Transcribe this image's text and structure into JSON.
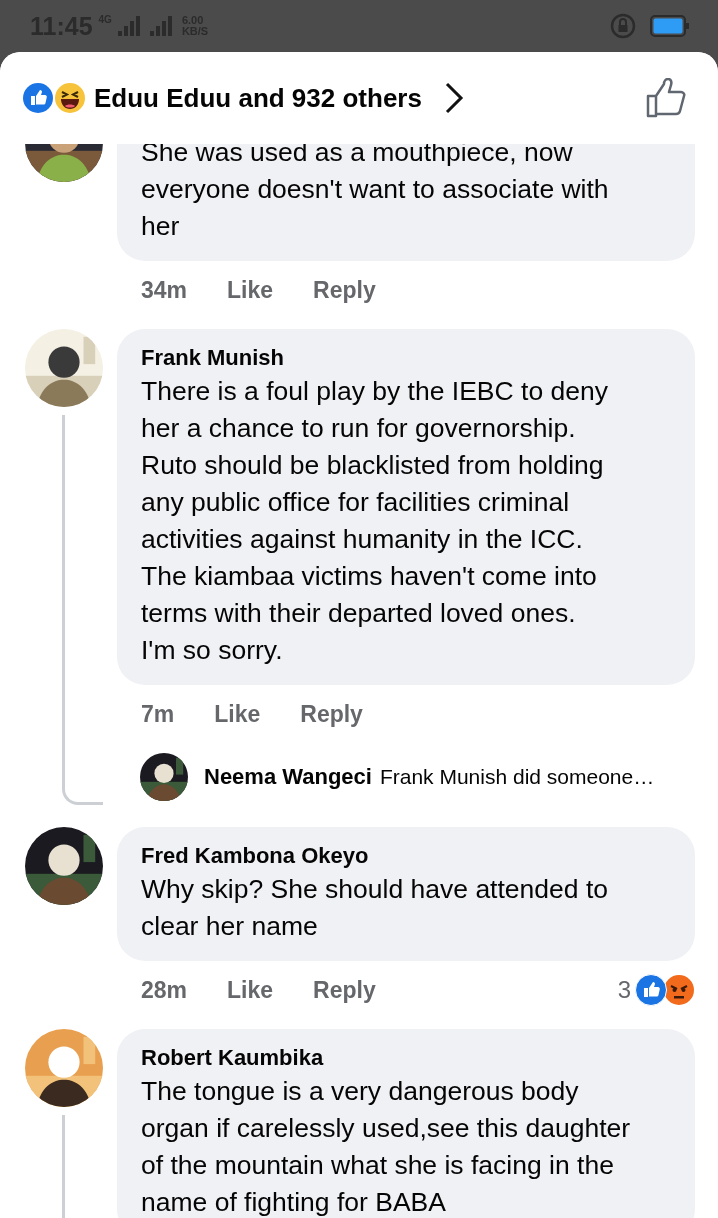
{
  "status_bar": {
    "time": "11:45",
    "network": "4G",
    "speed": "6.00",
    "speed_unit": "KB/S"
  },
  "header": {
    "reactions_text": "Eduu Eduu and 932 others"
  },
  "comments": [
    {
      "body": [
        "She was used as a mouthpiece, now",
        "everyone doesn't want to associate with",
        "her"
      ],
      "time": "34m",
      "like": "Like",
      "reply": "Reply"
    },
    {
      "name": "Frank Munish",
      "body": [
        "There is a foul play by the IEBC to deny",
        "her a chance to run for governorship.",
        "Ruto should be blacklisted from holding",
        "any public office for facilities criminal",
        "activities against humanity in the ICC.",
        "The kiambaa victims haven't come into",
        "terms with their departed loved ones.",
        "I'm so sorry."
      ],
      "time": "7m",
      "like": "Like",
      "reply": "Reply",
      "replies": [
        {
          "name": "Neema Wangeci",
          "text": "Frank Munish did someone…"
        }
      ]
    },
    {
      "name": "Fred Kambona Okeyo",
      "body": [
        "Why skip? She should have attended to",
        "clear her name"
      ],
      "time": "28m",
      "like": "Like",
      "reply": "Reply",
      "reaction_count": "3"
    },
    {
      "name": "Robert Kaumbika",
      "body": [
        "The tongue is a very dangerous body",
        "organ if carelessly used,see this daughter",
        "of the mountain what she is facing in the",
        "name of fighting for BABA"
      ],
      "thread_line": true
    }
  ]
}
